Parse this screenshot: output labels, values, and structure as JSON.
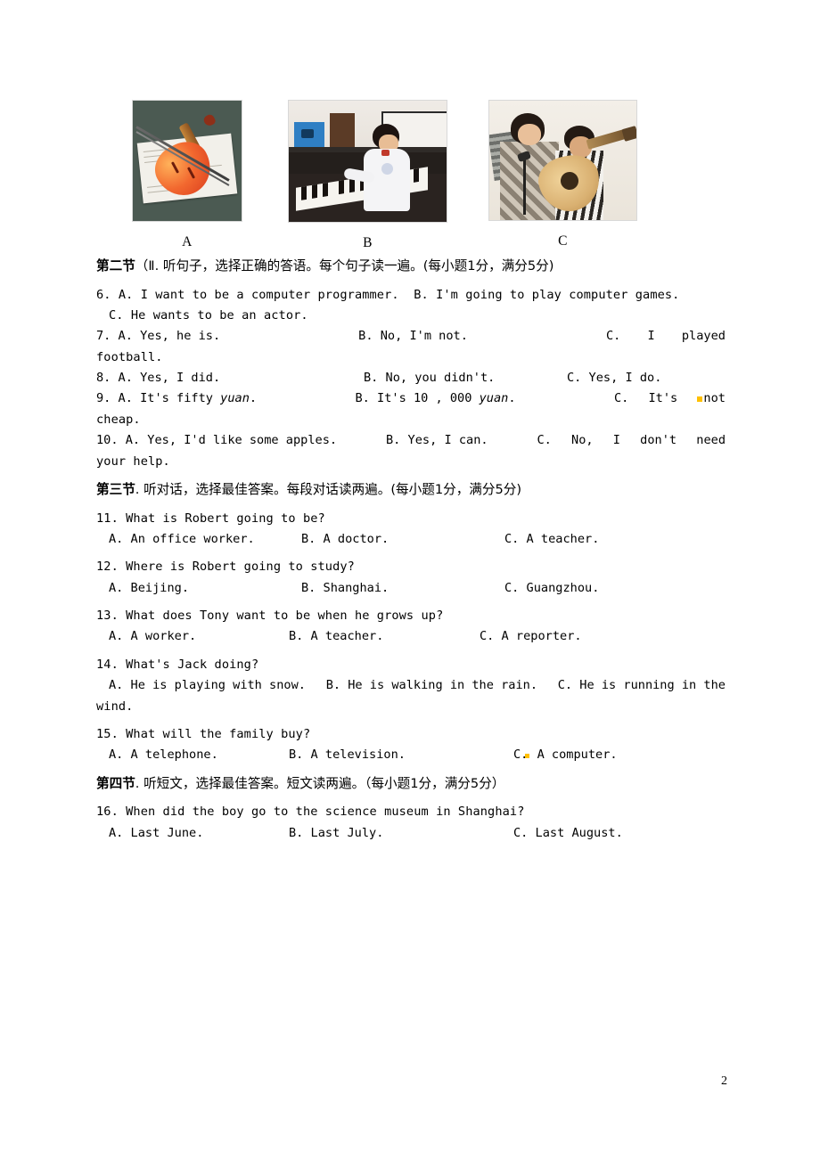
{
  "page": {
    "number": "2"
  },
  "figures": [
    {
      "label": "A",
      "alt": "violin-on-sheet-music-photo"
    },
    {
      "label": "B",
      "alt": "boy-playing-piano-photo"
    },
    {
      "label": "C",
      "alt": "woman-and-boy-playing-guitar-photo"
    }
  ],
  "sections": {
    "second": {
      "heading_bold": "第二节",
      "heading_rest": "（Ⅱ. 听句子，选择正确的答语。每个句子读一遍。(每小题1分，满分5分)"
    },
    "third": {
      "heading_bold": "第三节",
      "heading_rest": ". 听对话，选择最佳答案。每段对话读两遍。(每小题1分，满分5分)"
    },
    "fourth": {
      "heading_bold": "第四节",
      "heading_rest": ". 听短文，选择最佳答案。短文读两遍。（每小题1分，满分5分）"
    }
  },
  "questions": {
    "q6": {
      "line1_a": "6. A. I want to be a computer programmer.",
      "line1_b": "B. I'm going to play computer games.",
      "line2_c": "C. He wants to be an actor."
    },
    "q7": {
      "a": "7. A. Yes, he is.",
      "b": "B. No, I'm not.",
      "c": "C.",
      "c_rest": "I played",
      "cont": "football."
    },
    "q8": {
      "a": "8. A. Yes, I did.",
      "b": "B. No, you didn't.",
      "c": "C. Yes, I do."
    },
    "q9": {
      "a_pre": "9. A. It's fifty ",
      "a_em": "yuan",
      "a_post": ".",
      "b_pre": "B. It's 10 , 000 ",
      "b_em": "yuan",
      "b_post": ".",
      "c": "C.  It's",
      "c_rest": "not",
      "cont": "cheap."
    },
    "q10": {
      "a": "10. A. Yes, I'd like some apples.",
      "b": "B. Yes, I can.",
      "c": "C. No, I don't need",
      "cont": "your help."
    },
    "q11": {
      "stem": "11. What is Robert going to be?",
      "a": "A. An office worker.",
      "b": "B. A doctor.",
      "c": "C. A teacher."
    },
    "q12": {
      "stem": "12. Where is Robert going to study?",
      "a": "A. Beijing.",
      "b": "B. Shanghai.",
      "c": "C. Guangzhou."
    },
    "q13": {
      "stem": "13. What does Tony want to be when he grows up?",
      "a": "A. A worker.",
      "b": "B. A teacher.",
      "c": "C. A reporter."
    },
    "q14": {
      "stem": "14. What's Jack doing?",
      "a": "A. He is playing with snow.",
      "b": "B. He is walking in the rain.",
      "c": "C. He is running in the",
      "cont": "wind."
    },
    "q15": {
      "stem": "15. What will the family buy?",
      "a": "A. A telephone.",
      "b": "B. A television.",
      "c_letter": "C.",
      "c_rest": "A computer."
    },
    "q16": {
      "stem": "16. When did the boy go to the science museum in Shanghai?",
      "a": "A. Last June.",
      "b": "B. Last July.",
      "c": "C. Last August."
    }
  },
  "colors": {
    "highlight": "#ffc000",
    "text": "#000000",
    "page_background": "#ffffff"
  }
}
